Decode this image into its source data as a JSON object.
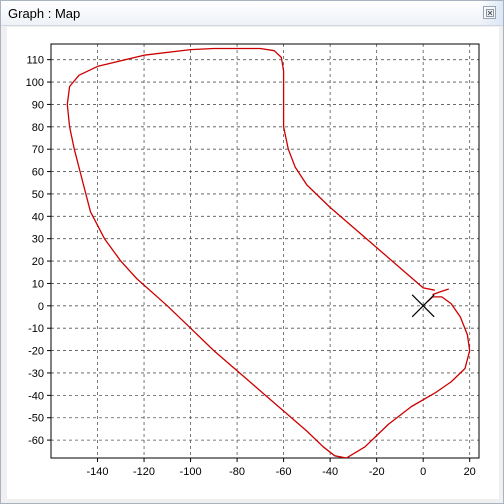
{
  "window": {
    "title": "Graph : Map",
    "close_icon": "close-icon"
  },
  "chart_data": {
    "type": "line",
    "title": "",
    "xlabel": "",
    "ylabel": "",
    "xlim": [
      -160,
      24
    ],
    "ylim": [
      -68,
      117
    ],
    "x_ticks": [
      -140,
      -120,
      -100,
      -80,
      -60,
      -40,
      -20,
      0,
      20
    ],
    "y_ticks": [
      110,
      100,
      90,
      80,
      70,
      60,
      50,
      40,
      30,
      20,
      10,
      0,
      -10,
      -20,
      -30,
      -40,
      -50,
      -60
    ],
    "grid": true,
    "line_color": "#cc0000",
    "marker": {
      "type": "x",
      "x": 0,
      "y": 0
    },
    "series": [
      {
        "points": [
          [
            5,
            7
          ],
          [
            0,
            8
          ],
          [
            -10,
            17
          ],
          [
            -20,
            26
          ],
          [
            -30,
            35
          ],
          [
            -40,
            44
          ],
          [
            -50,
            54
          ],
          [
            -55,
            62
          ],
          [
            -58,
            70
          ],
          [
            -60,
            80
          ],
          [
            -60,
            95
          ],
          [
            -60,
            105
          ],
          [
            -61,
            111
          ],
          [
            -64,
            114
          ],
          [
            -70,
            115
          ],
          [
            -80,
            115
          ],
          [
            -90,
            115
          ],
          [
            -100,
            114.5
          ],
          [
            -120,
            112
          ],
          [
            -140,
            107
          ],
          [
            -148,
            103
          ],
          [
            -152,
            98
          ],
          [
            -153,
            90
          ],
          [
            -152,
            80
          ],
          [
            -150,
            70
          ],
          [
            -147,
            58
          ],
          [
            -143,
            42
          ],
          [
            -137,
            30
          ],
          [
            -130,
            20
          ],
          [
            -123,
            12
          ],
          [
            -110,
            0
          ],
          [
            -100,
            -10
          ],
          [
            -90,
            -20
          ],
          [
            -80,
            -29
          ],
          [
            -70,
            -38
          ],
          [
            -60,
            -47
          ],
          [
            -50,
            -56
          ],
          [
            -43,
            -63
          ],
          [
            -38,
            -67
          ],
          [
            -33,
            -68
          ],
          [
            -25,
            -63
          ],
          [
            -15,
            -53
          ],
          [
            -5,
            -45
          ],
          [
            5,
            -39
          ],
          [
            12,
            -34
          ],
          [
            18,
            -28
          ],
          [
            20,
            -20
          ],
          [
            19,
            -13
          ],
          [
            16,
            -5
          ],
          [
            12,
            1
          ],
          [
            8,
            4
          ],
          [
            4,
            4
          ],
          [
            2,
            2
          ]
        ]
      },
      {
        "points": [
          [
            4,
            5
          ],
          [
            8,
            6.5
          ],
          [
            11,
            7.5
          ]
        ]
      }
    ]
  }
}
